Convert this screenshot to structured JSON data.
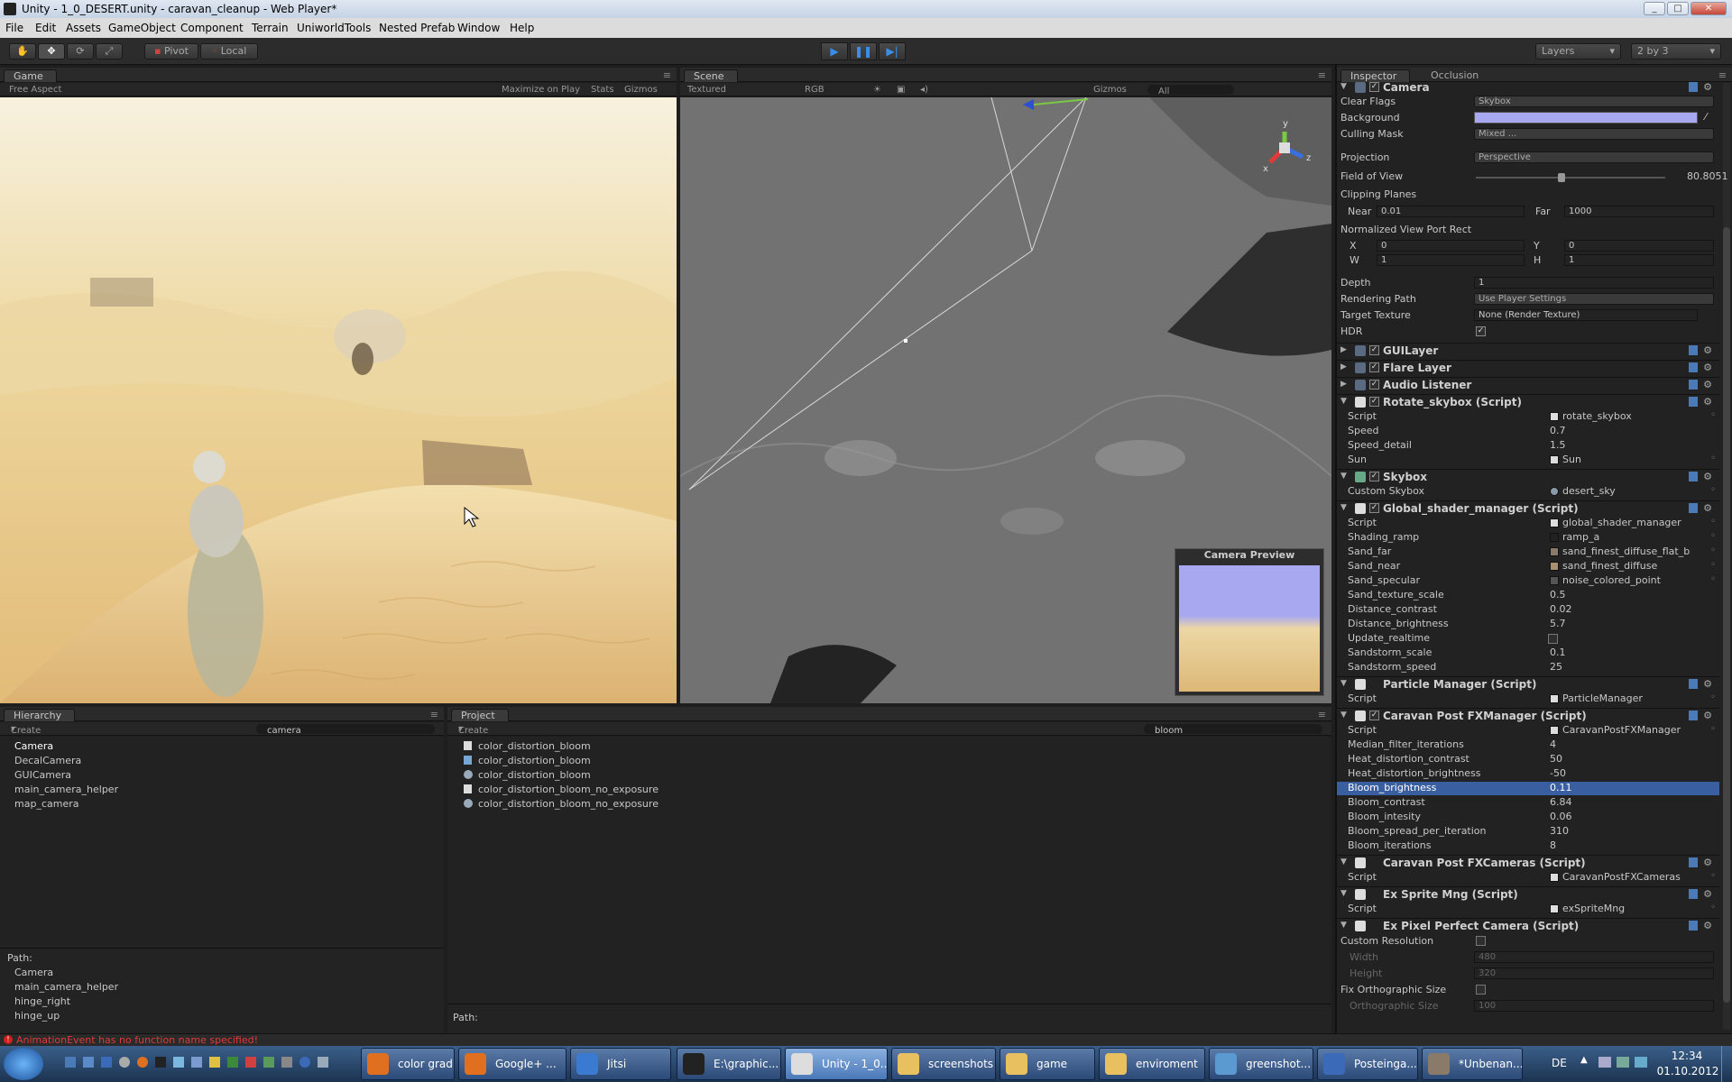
{
  "window": {
    "title": "Unity - 1_0_DESERT.unity - caravan_cleanup - Web Player*"
  },
  "menu": [
    "File",
    "Edit",
    "Assets",
    "GameObject",
    "Component",
    "Terrain",
    "UniworldTools",
    "Nested Prefab",
    "Window",
    "Help"
  ],
  "toolbar": {
    "pivot": "Pivot",
    "local": "Local",
    "layers": "Layers",
    "layout": "2 by 3"
  },
  "game": {
    "tab": "Game",
    "aspect": "Free Aspect",
    "maximize": "Maximize on Play",
    "stats": "Stats",
    "gizmos": "Gizmos"
  },
  "scene": {
    "tab": "Scene",
    "mode": "Textured",
    "rgb": "RGB",
    "gizmos": "Gizmos",
    "search": "All",
    "preview_title": "Camera Preview",
    "gizmo_y": "y",
    "gizmo_z": "z",
    "gizmo_x": "x"
  },
  "hierarchy": {
    "tab": "Hierarchy",
    "create": "Create",
    "search": "camera",
    "items": [
      "Camera",
      "DecalCamera",
      "GUICamera",
      "main_camera_helper",
      "map_camera"
    ],
    "path_label": "Path:",
    "path": [
      "Camera",
      "main_camera_helper",
      "hinge_right",
      "hinge_up"
    ]
  },
  "project": {
    "tab": "Project",
    "create": "Create",
    "search": "bloom",
    "items": [
      "color_distortion_bloom",
      "color_distortion_bloom",
      "color_distortion_bloom",
      "color_distortion_bloom_no_exposure",
      "color_distortion_bloom_no_exposure"
    ],
    "path_label": "Path:"
  },
  "inspector": {
    "tab": "Inspector",
    "tab2": "Occlusion",
    "camera": {
      "name": "Camera",
      "clear_flags_l": "Clear Flags",
      "clear_flags": "Skybox",
      "background_l": "Background",
      "background_color": "#a8a8f0",
      "culling_l": "Culling Mask",
      "culling": "Mixed ...",
      "projection_l": "Projection",
      "projection": "Perspective",
      "fov_l": "Field of View",
      "fov": "80.8051",
      "fov_fraction": 0.45,
      "clipping_l": "Clipping Planes",
      "near_l": "Near",
      "near": "0.01",
      "far_l": "Far",
      "far": "1000",
      "viewport_l": "Normalized View Port Rect",
      "x_l": "X",
      "x": "0",
      "y_l": "Y",
      "y": "0",
      "w_l": "W",
      "w": "1",
      "h_l": "H",
      "h": "1",
      "depth_l": "Depth",
      "depth": "1",
      "rpath_l": "Rendering Path",
      "rpath": "Use Player Settings",
      "target_l": "Target Texture",
      "target": "None (Render Texture)",
      "hdr_l": "HDR"
    },
    "components": [
      "GUILayer",
      "Flare Layer",
      "Audio Listener"
    ],
    "rotate": {
      "name": "Rotate_skybox (Script)",
      "rows": [
        [
          "Script",
          "rotate_skybox"
        ],
        [
          "Speed",
          "0.7"
        ],
        [
          "Speed_detail",
          "1.5"
        ],
        [
          "Sun",
          "Sun"
        ]
      ]
    },
    "skybox": {
      "name": "Skybox",
      "rows": [
        [
          "Custom Skybox",
          "desert_sky"
        ]
      ]
    },
    "global": {
      "name": "Global_shader_manager (Script)",
      "rows": [
        [
          "Script",
          "global_shader_manager"
        ],
        [
          "Shading_ramp",
          "ramp_a"
        ],
        [
          "Sand_far",
          "sand_finest_diffuse_flat_b"
        ],
        [
          "Sand_near",
          "sand_finest_diffuse"
        ],
        [
          "Sand_specular",
          "noise_colored_point"
        ],
        [
          "Sand_texture_scale",
          "0.5"
        ],
        [
          "Distance_contrast",
          "0.02"
        ],
        [
          "Distance_brightness",
          "5.7"
        ],
        [
          "Update_realtime",
          ""
        ],
        [
          "Sandstorm_scale",
          "0.1"
        ],
        [
          "Sandstorm_speed",
          "25"
        ]
      ]
    },
    "particle": {
      "name": "Particle Manager (Script)",
      "rows": [
        [
          "Script",
          "ParticleManager"
        ]
      ]
    },
    "postfx": {
      "name": "Caravan Post FXManager (Script)",
      "rows": [
        [
          "Script",
          "CaravanPostFXManager"
        ],
        [
          "Median_filter_iterations",
          "4"
        ],
        [
          "Heat_distortion_contrast",
          "50"
        ],
        [
          "Heat_distortion_brightness",
          "-50"
        ],
        [
          "Bloom_brightness",
          "0.11"
        ],
        [
          "Bloom_contrast",
          "6.84"
        ],
        [
          "Bloom_intesity",
          "0.06"
        ],
        [
          "Bloom_spread_per_iteration",
          "310"
        ],
        [
          "Bloom_iterations",
          "8"
        ]
      ]
    },
    "postcams": {
      "name": "Caravan Post FXCameras (Script)",
      "rows": [
        [
          "Script",
          "CaravanPostFXCameras"
        ]
      ]
    },
    "sprite": {
      "name": "Ex Sprite Mng (Script)",
      "rows": [
        [
          "Script",
          "exSpriteMng"
        ]
      ]
    },
    "pixel": {
      "name": "Ex Pixel Perfect Camera (Script)",
      "custom_l": "Custom Resolution",
      "width_l": "Width",
      "width": "480",
      "height_l": "Height",
      "height": "320",
      "fix_l": "Fix Orthographic Size",
      "ortho_l": "Orthographic Size",
      "ortho": "100"
    }
  },
  "status": {
    "error": "AnimationEvent has no function name specified!"
  },
  "taskbar": {
    "items": [
      "color grad...",
      "Google+ ...",
      "Jitsi",
      "E:\\graphic...",
      "Unity - 1_0...",
      "screenshots",
      "game",
      "enviroment",
      "greenshot...",
      "Posteinga...",
      "*Unbenan..."
    ],
    "lang": "DE",
    "time": "12:34",
    "date": "01.10.2012"
  }
}
